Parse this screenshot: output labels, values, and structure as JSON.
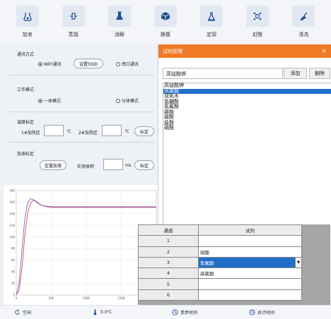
{
  "toolbar": {
    "items": [
      {
        "label": "加液",
        "icon": "flask-add-icon"
      },
      {
        "label": "蒸馏",
        "icon": "distill-icon"
      },
      {
        "label": "消解",
        "icon": "digest-beaker-icon"
      },
      {
        "label": "静置",
        "icon": "cube-icon"
      },
      {
        "label": "定容",
        "icon": "volumetric-flask-icon"
      },
      {
        "label": "赶酸",
        "icon": "molecule-icon"
      },
      {
        "label": "清洗",
        "icon": "cleaning-icon"
      }
    ]
  },
  "comm": {
    "title": "通讯方式",
    "wifi": "WIFI通讯",
    "set_ssid": "设置SSID",
    "serial": "串口通讯"
  },
  "mode": {
    "title": "工作模式",
    "single": "一体模式",
    "split": "分体模式"
  },
  "temp_cal": {
    "title": "温度标定",
    "zone1": "1#加热区",
    "zone2": "2#加热区",
    "unit": "℃",
    "zone1_value": "",
    "zone2_value": "",
    "calibrate": "标定"
  },
  "dose_cal": {
    "title": "加液标定",
    "fixed": "定量加液",
    "measured": "实测体积",
    "unit": "mL",
    "value": "",
    "calibrate": "标定"
  },
  "chart_data": {
    "type": "line",
    "x_ticks": [
      "0",
      "500",
      "1000",
      "1500",
      "2000"
    ],
    "y_ticks": [
      "0",
      "20",
      "40",
      "60",
      "80",
      "100",
      "120",
      "140",
      "160",
      "180"
    ],
    "xlim": [
      0,
      2000
    ],
    "ylim": [
      0,
      180
    ],
    "series": [
      {
        "color": "#e04848",
        "x": [
          0,
          40,
          80,
          120,
          160,
          200,
          240,
          280,
          320,
          380,
          440,
          520,
          600,
          800,
          1000,
          1500,
          2000
        ],
        "y": [
          0,
          8,
          45,
          100,
          140,
          158,
          163,
          162,
          158,
          154,
          152,
          151,
          151,
          151,
          151,
          151,
          151
        ]
      },
      {
        "color": "#6a6ad8",
        "x": [
          0,
          40,
          80,
          120,
          160,
          200,
          240,
          280,
          320,
          380,
          440,
          520,
          600,
          800,
          1000,
          1500,
          2000
        ],
        "y": [
          0,
          20,
          75,
          130,
          158,
          166,
          165,
          161,
          157,
          154,
          153,
          152,
          152,
          152,
          152,
          152,
          152
        ]
      }
    ]
  },
  "dialog": {
    "title": "试剂管理",
    "close": "×",
    "input_value": "高锰酸钾",
    "add": "添加",
    "delete": "删除",
    "reagents": [
      "高锰酸钾",
      "高氯酸",
      "双氧水",
      "氢硼酸",
      "氢氟酸",
      "磷酸",
      "硫酸",
      "盐酸",
      "硝酸"
    ],
    "selected_index": 1
  },
  "reagent_table": {
    "headers": [
      "通道",
      "试剂"
    ],
    "rows": [
      {
        "channel": "1",
        "reagent": ""
      },
      {
        "channel": "2",
        "reagent": "硝酸"
      },
      {
        "channel": "3",
        "reagent": "氢氟酸"
      },
      {
        "channel": "4",
        "reagent": "高氯酸"
      },
      {
        "channel": "5",
        "reagent": ""
      },
      {
        "channel": "6",
        "reagent": ""
      }
    ],
    "selected_row": 3
  },
  "status": {
    "idle": "空闲",
    "temp": "0.0℃",
    "step_time": "单步时间",
    "total_time": "总计时间"
  }
}
